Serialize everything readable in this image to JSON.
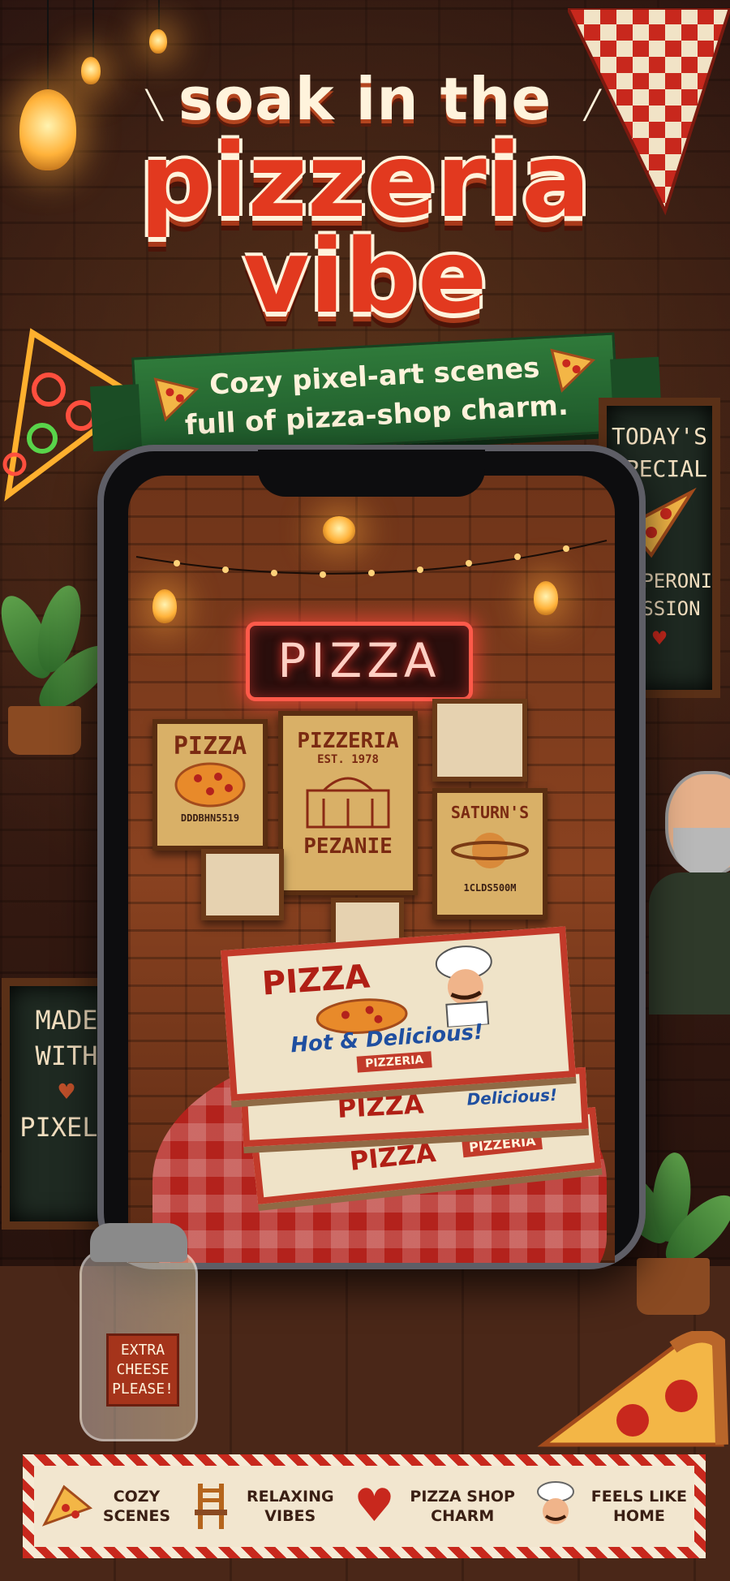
{
  "headline": {
    "line1": "soak in the",
    "line2": "pizzeria",
    "line3": "vibe"
  },
  "banner": {
    "line1": "Cozy pixel-art scenes",
    "line2": "full of pizza-shop charm."
  },
  "specials_board": {
    "title_line1": "TODAY'S",
    "title_line2": "SPECIAL",
    "item_line1": "PEPPERONI",
    "item_line2": "PASSION"
  },
  "made_with_board": {
    "line1": "MADE",
    "line2": "WITH",
    "line3": "PIXELS"
  },
  "shaker_label": {
    "line1": "EXTRA",
    "line2": "CHEESE",
    "line3": "PLEASE!"
  },
  "scene": {
    "neon_sign": "PIZZA",
    "poster_left": {
      "title": "PIZZA",
      "code": "DDDBHN5519"
    },
    "poster_center": {
      "title": "PIZZERIA",
      "est": "EST.",
      "year": "1978",
      "footer": "PEZANIE"
    },
    "poster_right": {
      "title": "SATURN'S",
      "code": "1CLDS500M"
    },
    "box_top": {
      "brand": "PIZZA",
      "tagline": "Hot & Delicious!",
      "ribbon": "PIZZERIA"
    },
    "box_mid": {
      "brand": "PIZZA",
      "tagline": "Delicious!"
    },
    "box_bottom": {
      "brand": "PIZZA",
      "ribbon": "PIZZERIA"
    }
  },
  "features": [
    {
      "icon": "pizza-slice-icon",
      "label": "COZY\nSCENES"
    },
    {
      "icon": "chair-icon",
      "label": "RELAXING\nVIBES"
    },
    {
      "icon": "heart-icon",
      "label": "PIZZA SHOP\nCHARM"
    },
    {
      "icon": "chef-icon",
      "label": "FEELS LIKE\nHOME"
    }
  ],
  "colors": {
    "accent_red": "#e2391f",
    "banner_green": "#2f7a3a",
    "cream": "#fff3dc",
    "neon_red": "#ff5a4a"
  }
}
